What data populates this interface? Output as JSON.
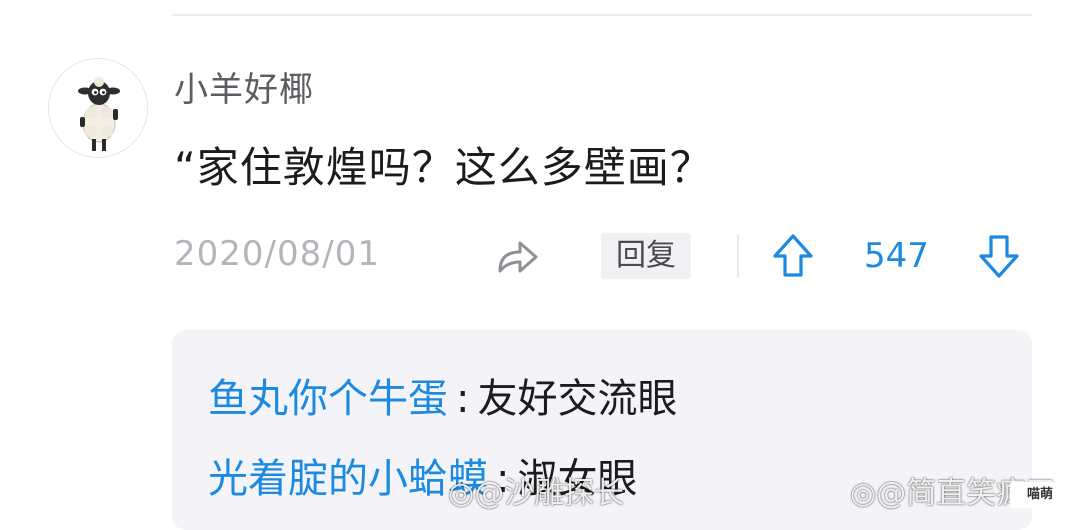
{
  "comment": {
    "username": "小羊好椰",
    "text": "“家住敦煌吗？这么多壁画？",
    "date": "2020/08/01",
    "reply_label": "回复",
    "vote_count": "547"
  },
  "replies": [
    {
      "author": "鱼丸你个牛蛋",
      "separator": ":",
      "text": "友好交流眼"
    },
    {
      "author": "光着腚的小蛤蟆",
      "separator": ":",
      "text": "淑女眼"
    }
  ],
  "watermarks": {
    "left": "@沙雕探长",
    "right": "@简直笑疯了",
    "logo": "喵萌"
  },
  "colors": {
    "accent": "#1b8ae0",
    "text": "#1c1c1f",
    "muted": "#b4b4bb",
    "reply_bg": "#f4f4f8"
  },
  "icons": {
    "share": "share-arrow-icon",
    "upvote": "arrow-up-icon",
    "downvote": "arrow-down-icon",
    "avatar": "sheep-avatar"
  }
}
